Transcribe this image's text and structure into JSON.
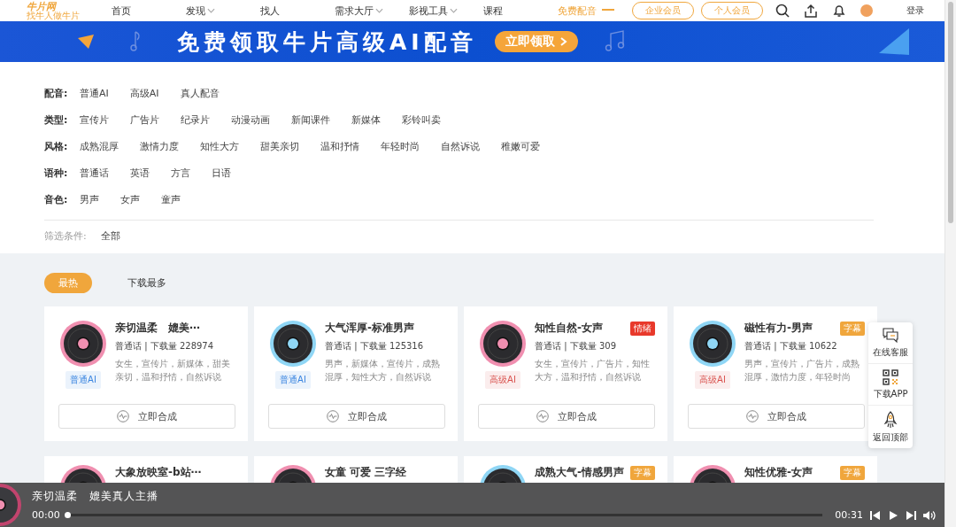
{
  "header": {
    "logo": "牛片网",
    "tagline": "找牛人做牛片",
    "nav": [
      {
        "label": "首页",
        "dropdown": false,
        "highlighted": false
      },
      {
        "label": "发现",
        "dropdown": true,
        "highlighted": false
      },
      {
        "label": "找人",
        "dropdown": false,
        "highlighted": false
      },
      {
        "label": "需求大厅",
        "dropdown": true,
        "highlighted": false
      },
      {
        "label": "影视工具",
        "dropdown": true,
        "highlighted": false
      },
      {
        "label": "课程",
        "dropdown": false,
        "highlighted": false
      },
      {
        "label": "免费配音",
        "dropdown": false,
        "highlighted": true
      }
    ],
    "member_buttons": [
      "企业会员",
      "个人会员"
    ],
    "login": "登录"
  },
  "banner": {
    "title": "免费领取牛片高级AI配音",
    "button": "立即领取"
  },
  "filters": [
    {
      "label": "配音:",
      "options": [
        "普通AI",
        "高级AI",
        "真人配音"
      ]
    },
    {
      "label": "类型:",
      "options": [
        "宣传片",
        "广告片",
        "纪录片",
        "动漫动画",
        "新闻课件",
        "新媒体",
        "彩铃叫卖"
      ]
    },
    {
      "label": "风格:",
      "options": [
        "成熟混厚",
        "激情力度",
        "知性大方",
        "甜美亲切",
        "温和抒情",
        "年轻时尚",
        "自然诉说",
        "稚嫩可爱"
      ]
    },
    {
      "label": "语种:",
      "options": [
        "普通话",
        "英语",
        "方言",
        "日语"
      ]
    },
    {
      "label": "音色:",
      "options": [
        "男声",
        "女声",
        "童声"
      ]
    }
  ],
  "condition": {
    "label": "筛选条件:",
    "value": "全部"
  },
  "sort_tabs": [
    {
      "label": "最热",
      "selected": true
    },
    {
      "label": "下载最多",
      "selected": false
    }
  ],
  "cards": [
    {
      "title": "亲切温柔　媲美⋯",
      "stats": "普通话 | 下载量 228974",
      "desc": "女生，宣传片，新媒体，甜美亲切，温和抒情，自然诉说",
      "tag": {
        "label": "普通AI",
        "color": "#3c86e0"
      },
      "color": "#f08fb0",
      "button": "立即合成"
    },
    {
      "title": "大气浑厚-标准男声",
      "stats": "普通话 | 下载量 125316",
      "desc": "男声，新媒体，宣传片，成熟混厚，知性大方，自然诉说",
      "tag": {
        "label": "普通AI",
        "color": "#3c86e0"
      },
      "color": "#8fd6f5",
      "button": "立即合成"
    },
    {
      "title": "知性自然-女声",
      "badge": {
        "label": "情绪",
        "color": "#e8392b"
      },
      "stats": "普通话 | 下载量 309",
      "desc": "女生，宣传片，广告片，知性大方，温和抒情，自然诉说",
      "tag": {
        "label": "高级AI",
        "color": "#d9534f"
      },
      "color": "#f08fb0",
      "button": "立即合成"
    },
    {
      "title": "磁性有力-男声",
      "badge": {
        "label": "字幕",
        "color": "#f0a63c"
      },
      "stats": "普通话 | 下载量 10622",
      "desc": "男声，宣传片，广告片，成熟混厚，激情力度，年轻时尚",
      "tag": {
        "label": "高级AI",
        "color": "#d9534f"
      },
      "color": "#8fd6f5",
      "button": "立即合成"
    },
    {
      "title": "大象放映室-b站⋯",
      "color": "#f08fb0"
    },
    {
      "title": "女童 可爱 三字经",
      "color": "#f08fb0"
    },
    {
      "title": "成熟大气-情感男声",
      "badge": {
        "label": "字幕",
        "color": "#f0a63c"
      },
      "color": "#8fd6f5"
    },
    {
      "title": "知性优雅-女声",
      "badge": {
        "label": "字幕",
        "color": "#f0a63c"
      },
      "color": "#f08fb0"
    }
  ],
  "side_panel": [
    {
      "kind": "chat",
      "label": "在线客服"
    },
    {
      "kind": "qr",
      "label": "下载APP"
    },
    {
      "kind": "rocket",
      "label": "返回顶部"
    }
  ],
  "player": {
    "title": "亲切温柔　媲美真人主播",
    "current": "00:00",
    "duration": "00:31",
    "level": 0
  }
}
